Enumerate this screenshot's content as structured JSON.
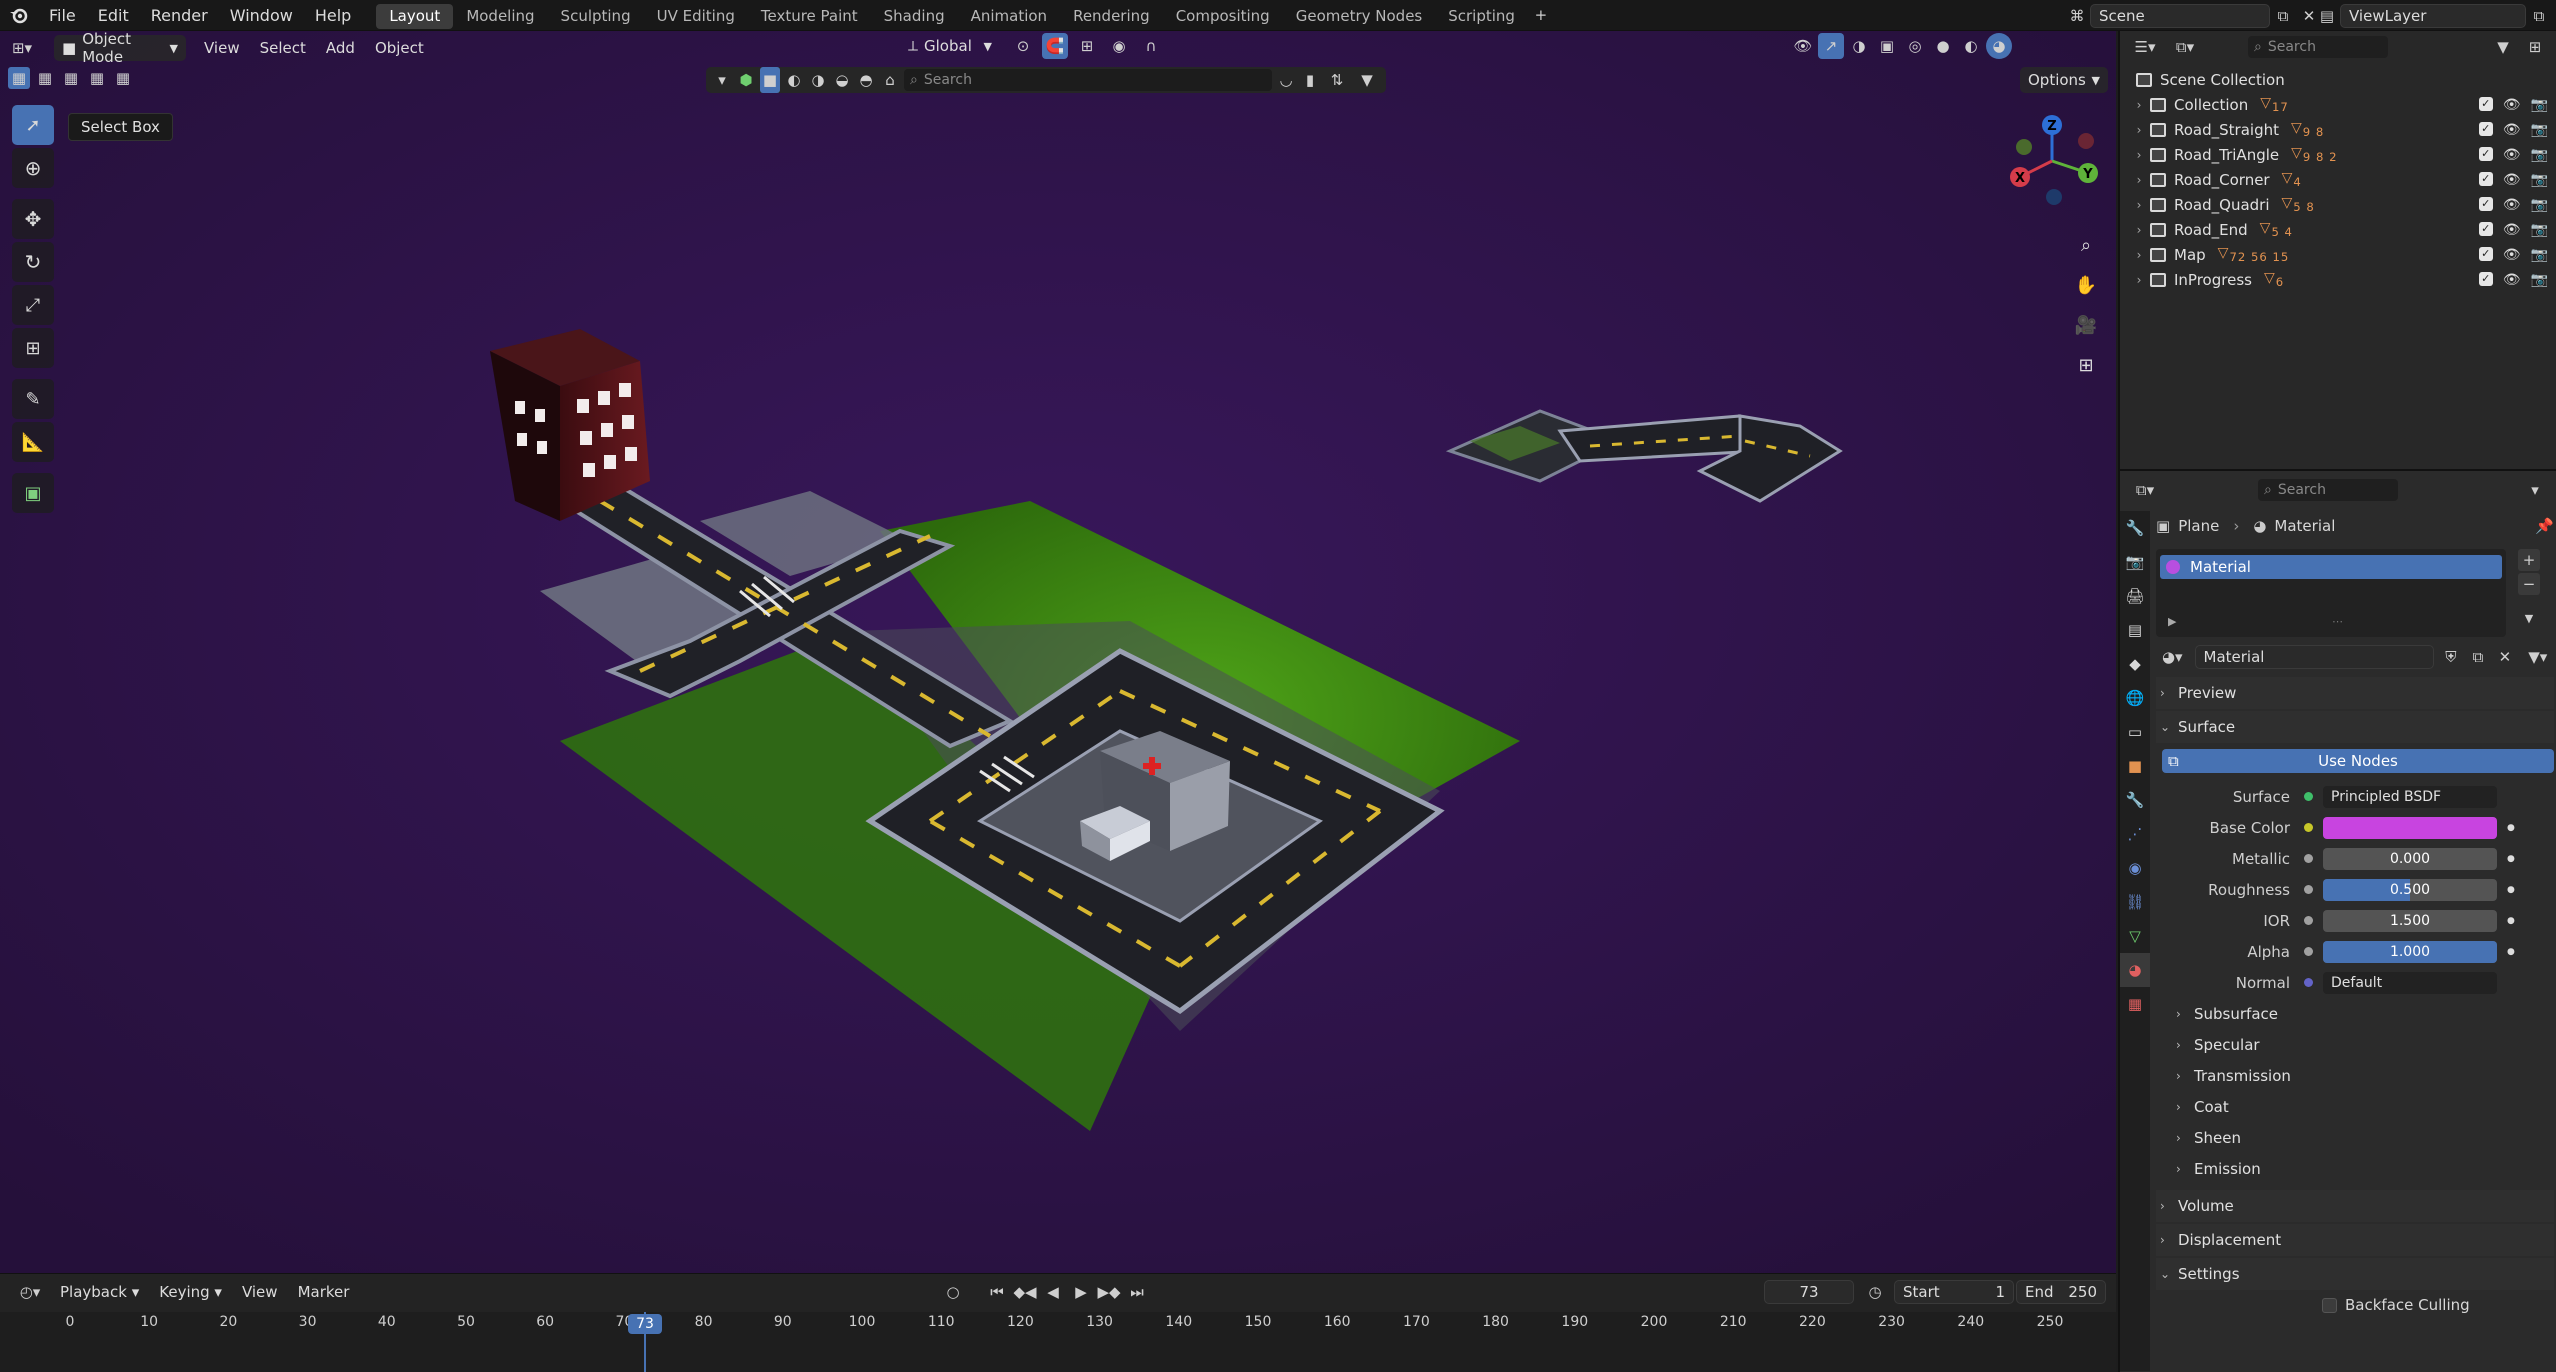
{
  "topbar": {
    "menus": [
      "File",
      "Edit",
      "Render",
      "Window",
      "Help"
    ],
    "workspaces": [
      "Layout",
      "Modeling",
      "Sculpting",
      "UV Editing",
      "Texture Paint",
      "Shading",
      "Animation",
      "Rendering",
      "Compositing",
      "Geometry Nodes",
      "Scripting"
    ],
    "active_workspace": "Layout",
    "scene_label": "Scene",
    "view_layer_label": "ViewLayer"
  },
  "viewport": {
    "mode": "Object Mode",
    "menus": [
      "View",
      "Select",
      "Add",
      "Object"
    ],
    "transform_orientation": "Global",
    "search_placeholder": "Search",
    "options_label": "Options",
    "tooltip": "Select Box",
    "gizmo": {
      "x": "X",
      "y": "Y",
      "z": "Z"
    }
  },
  "timeline": {
    "menus": [
      "Playback",
      "Keying",
      "View",
      "Marker"
    ],
    "current_frame": "73",
    "start_label": "Start",
    "start_value": "1",
    "end_label": "End",
    "end_value": "250",
    "ticks": [
      "0",
      "10",
      "20",
      "30",
      "40",
      "50",
      "60",
      "70",
      "80",
      "90",
      "100",
      "110",
      "120",
      "130",
      "140",
      "150",
      "160",
      "170",
      "180",
      "190",
      "200",
      "210",
      "220",
      "230",
      "240",
      "250"
    ]
  },
  "outliner": {
    "search_placeholder": "Search",
    "root": "Scene Collection",
    "items": [
      {
        "name": "Collection",
        "counts": "17"
      },
      {
        "name": "Road_Straight",
        "counts": "9 8"
      },
      {
        "name": "Road_TriAngle",
        "counts": "9 8 2"
      },
      {
        "name": "Road_Corner",
        "counts": "4"
      },
      {
        "name": "Road_Quadri",
        "counts": "5 8"
      },
      {
        "name": "Road_End",
        "counts": "5 4"
      },
      {
        "name": "Map",
        "counts": "72 56 15"
      },
      {
        "name": "InProgress",
        "counts": "6"
      }
    ]
  },
  "properties": {
    "search_placeholder": "Search",
    "breadcrumb_object": "Plane",
    "breadcrumb_material": "Material",
    "slot_name": "Material",
    "material_name": "Material",
    "panels": {
      "preview": "Preview",
      "surface": "Surface",
      "use_nodes": "Use Nodes",
      "volume": "Volume",
      "displacement": "Displacement",
      "settings": "Settings",
      "backface_culling": "Backface Culling"
    },
    "surface_rows": [
      {
        "label": "Surface",
        "value": "Principled BSDF",
        "kind": "shader",
        "dot": "#3fbf6a"
      },
      {
        "label": "Base Color",
        "value": "",
        "kind": "color",
        "dot": "#c7c729",
        "color": "#c844e0"
      },
      {
        "label": "Metallic",
        "value": "0.000",
        "kind": "slider",
        "fill": 0,
        "dot": "#a1a1a1"
      },
      {
        "label": "Roughness",
        "value": "0.500",
        "kind": "slider",
        "fill": 0.5,
        "dot": "#a1a1a1"
      },
      {
        "label": "IOR",
        "value": "1.500",
        "kind": "slider",
        "fill": 0,
        "dot": "#a1a1a1"
      },
      {
        "label": "Alpha",
        "value": "1.000",
        "kind": "slider",
        "fill": 1,
        "dot": "#a1a1a1"
      },
      {
        "label": "Normal",
        "value": "Default",
        "kind": "vector",
        "dot": "#6363c7"
      }
    ],
    "subpanels": [
      "Subsurface",
      "Specular",
      "Transmission",
      "Coat",
      "Sheen",
      "Emission"
    ]
  },
  "colors": {
    "accent": "#4772b3",
    "viewport_bg": "#2d1244",
    "grass": "#3d8a12",
    "road": "#1e1f24",
    "base_color": "#c844e0"
  }
}
